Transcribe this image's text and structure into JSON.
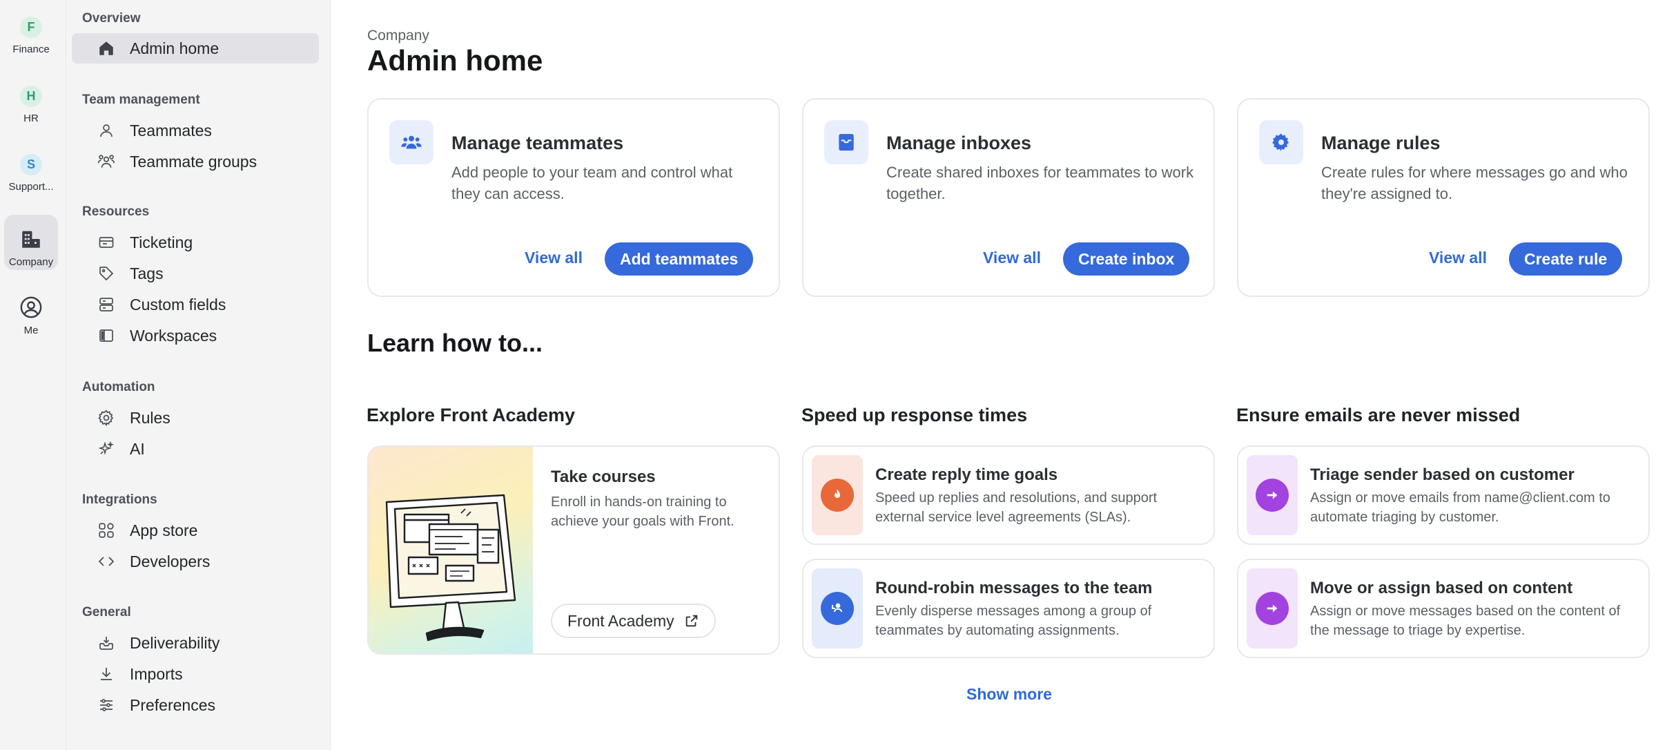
{
  "workspaces": [
    {
      "initial": "F",
      "label": "Finance",
      "color": "#2f9e6e",
      "bg": "#d9f1e4"
    },
    {
      "initial": "H",
      "label": "HR",
      "color": "#2f9e6e",
      "bg": "#d9f1e4"
    },
    {
      "initial": "S",
      "label": "Support...",
      "color": "#2f86c4",
      "bg": "#d6ecf6"
    },
    {
      "label": "Company",
      "icon": "building-icon",
      "active": true
    },
    {
      "label": "Me",
      "icon": "user-circle-icon"
    }
  ],
  "nav": {
    "sections": {
      "overview": "Overview",
      "team": "Team management",
      "resources": "Resources",
      "automation": "Automation",
      "integrations": "Integrations",
      "general": "General"
    },
    "items": {
      "admin_home": "Admin home",
      "teammates": "Teammates",
      "teammate_groups": "Teammate groups",
      "ticketing": "Ticketing",
      "tags": "Tags",
      "custom_fields": "Custom fields",
      "workspaces": "Workspaces",
      "rules": "Rules",
      "ai": "AI",
      "app_store": "App store",
      "developers": "Developers",
      "deliverability": "Deliverability",
      "imports": "Imports",
      "preferences": "Preferences"
    }
  },
  "header": {
    "breadcrumb": "Company",
    "title": "Admin home"
  },
  "cards": [
    {
      "title": "Manage teammates",
      "desc": "Add people to your team and control what they can access.",
      "view_all": "View all",
      "primary": "Add teammates",
      "icon": "users-icon"
    },
    {
      "title": "Manage inboxes",
      "desc": "Create shared inboxes for teammates to work together.",
      "view_all": "View all",
      "primary": "Create inbox",
      "icon": "inbox-icon"
    },
    {
      "title": "Manage rules",
      "desc": "Create rules for where messages go and who they're assigned to.",
      "view_all": "View all",
      "primary": "Create rule",
      "icon": "gear-icon"
    }
  ],
  "learn": {
    "title": "Learn how to...",
    "columns": [
      "Explore Front Academy",
      "Speed up response times",
      "Ensure emails are never missed"
    ],
    "academy": {
      "title": "Take courses",
      "desc": "Enroll in hands-on training to achieve your goals with Front.",
      "button": "Front Academy"
    },
    "tips": [
      {
        "title": "Create reply time goals",
        "desc": "Speed up replies and resolutions, and support external service level agreements (SLAs).",
        "icon": "flame-icon",
        "accent": "#e8683a",
        "bg": "#fbe6df"
      },
      {
        "title": "Round-robin messages to the team",
        "desc": "Evenly disperse messages among a group of teammates by automating assignments.",
        "icon": "round-robin-icon",
        "accent": "#3569dc",
        "bg": "#e4ebfa"
      },
      {
        "title": "Triage sender based on customer",
        "desc": "Assign or move emails from name@client.com to automate triaging by customer.",
        "icon": "arrow-right-icon",
        "accent": "#a243e0",
        "bg": "#f1e4fb"
      },
      {
        "title": "Move or assign based on content",
        "desc": "Assign or move messages based on the content of the message to triage by expertise.",
        "icon": "arrow-right-icon",
        "accent": "#a243e0",
        "bg": "#f1e4fb"
      }
    ],
    "show_more": "Show more"
  }
}
